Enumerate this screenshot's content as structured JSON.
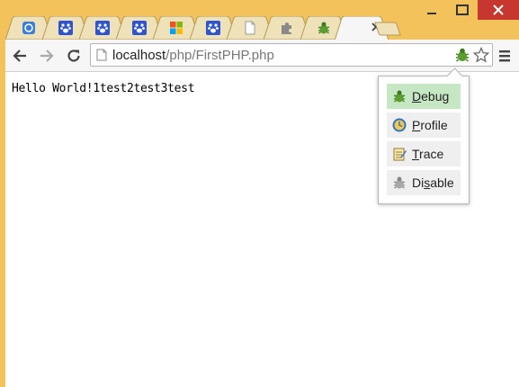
{
  "window": {
    "controls": [
      "minimize",
      "maximize",
      "close"
    ]
  },
  "tabs": [
    {
      "icon": "chrome-apps-icon",
      "active": false
    },
    {
      "icon": "baidu-paw-icon",
      "active": false
    },
    {
      "icon": "baidu-paw-icon",
      "active": false
    },
    {
      "icon": "baidu-paw-icon",
      "active": false
    },
    {
      "icon": "windows-logo-icon",
      "active": false
    },
    {
      "icon": "baidu-paw-icon",
      "active": false
    },
    {
      "icon": "blank-page-icon",
      "active": false
    },
    {
      "icon": "puzzle-extension-icon",
      "active": false
    },
    {
      "icon": "bug-icon",
      "active": false
    },
    {
      "icon": "none",
      "active": true
    }
  ],
  "omnibox": {
    "host": "localhost",
    "path": "/php/FirstPHP.php"
  },
  "page": {
    "text": "Hello World!1test2test3test"
  },
  "debug_popup": {
    "items": [
      {
        "label": "Debug",
        "accel": "D",
        "icon": "bug-icon",
        "active": true
      },
      {
        "label": "Profile",
        "accel": "P",
        "icon": "clock-icon",
        "active": false
      },
      {
        "label": "Trace",
        "accel": "T",
        "icon": "notepad-icon",
        "active": false
      },
      {
        "label": "Disable",
        "accel": "s",
        "icon": "bug-gray-icon",
        "active": false
      }
    ]
  },
  "colors": {
    "frame": "#f3c25b",
    "active_item": "#c6e7c3",
    "item": "#efefef",
    "close_button": "#c7372f"
  }
}
